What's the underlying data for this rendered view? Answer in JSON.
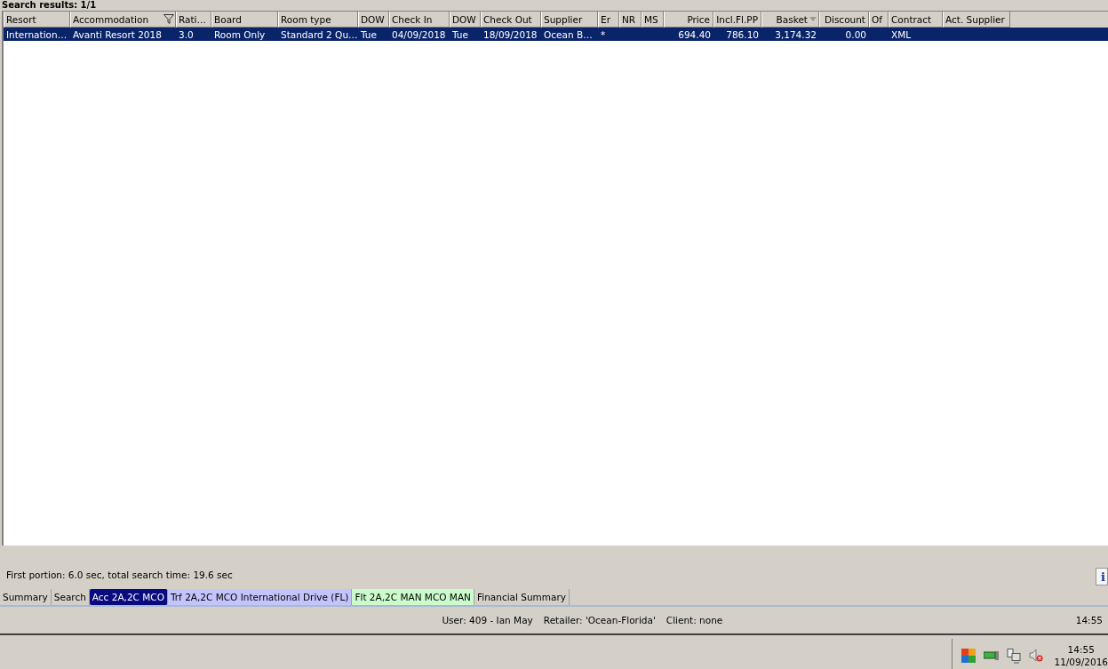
{
  "results_title": "Search results: 1/1",
  "table": {
    "columns": [
      "Resort",
      "Accommodation",
      "Rati…",
      "Board",
      "Room type",
      "DOW",
      "Check In",
      "DOW",
      "Check Out",
      "Supplier",
      "Er",
      "NR",
      "MS",
      "Price",
      "Incl.Fl.PP",
      "Basket",
      "Discount",
      "Of",
      "Contract",
      "Act. Supplier"
    ],
    "rows": [
      {
        "selected": true,
        "cells": [
          "Internation…",
          "Avanti Resort 2018",
          "3.0",
          "Room Only",
          "Standard 2 Qu…",
          "Tue",
          "04/09/2018",
          "Tue",
          "18/09/2018",
          "Ocean B…",
          "*",
          "",
          "",
          "694.40",
          "786.10",
          "3,174.32",
          "0.00",
          "",
          "XML",
          ""
        ]
      }
    ]
  },
  "search_time": "First portion: 6.0 sec, total search time: 19.6 sec",
  "info_button": "i",
  "tabs": [
    {
      "label": "Summary",
      "selected": false,
      "color": "#d4d0c8"
    },
    {
      "label": "Search",
      "selected": false,
      "color": "#d4d0c8"
    },
    {
      "label": "Acc 2A,2C MCO",
      "selected": true,
      "color": "#0a0a80"
    },
    {
      "label": "Trf 2A,2C MCO International Drive (FL)",
      "selected": false,
      "color": "#c4c4fc"
    },
    {
      "label": "Flt 2A,2C MAN MCO MAN",
      "selected": false,
      "color": "#ccfccc"
    },
    {
      "label": "Financial Summary",
      "selected": false,
      "color": "#d4d0c8"
    }
  ],
  "status_bar": {
    "user": "User: 409 - Ian May",
    "retailer": "Retailer: 'Ocean-Florida'",
    "client": "Client: none",
    "time": "14:55"
  },
  "taskbar": {
    "clock_time": "14:55",
    "clock_date": "11/09/2016"
  }
}
